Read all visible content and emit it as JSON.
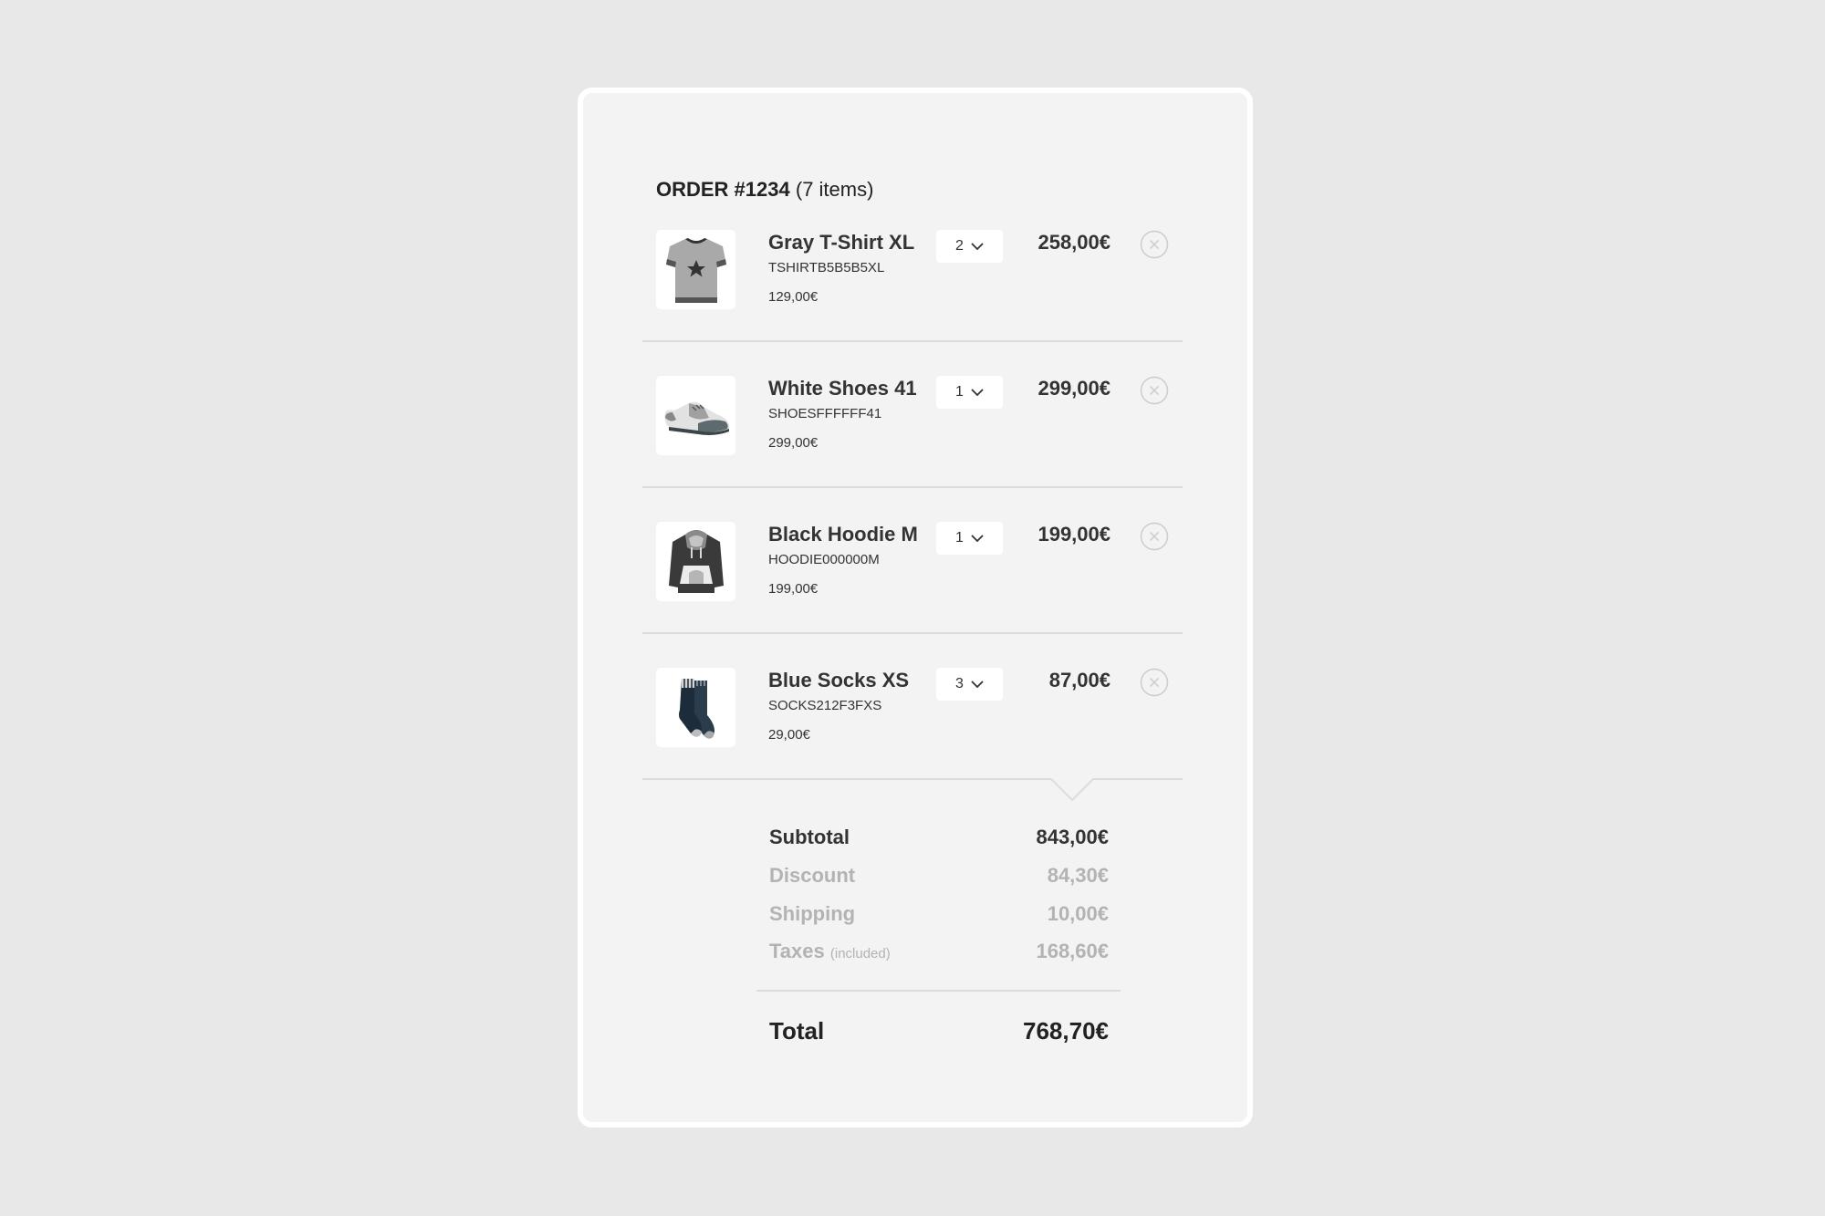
{
  "order": {
    "id_label": "ORDER #1234",
    "items_label": "(7 items)"
  },
  "items": [
    {
      "name": "Gray T-Shirt XL",
      "sku": "TSHIRTB5B5B5XL",
      "unit_price": "129,00€",
      "quantity": "2",
      "total": "258,00€",
      "icon": "t-shirt-icon"
    },
    {
      "name": "White Shoes 41",
      "sku": "SHOESFFFFFF41",
      "unit_price": "299,00€",
      "quantity": "1",
      "total": "299,00€",
      "icon": "shoe-icon"
    },
    {
      "name": "Black Hoodie M",
      "sku": "HOODIE000000M",
      "unit_price": "199,00€",
      "quantity": "1",
      "total": "199,00€",
      "icon": "hoodie-icon"
    },
    {
      "name": "Blue Socks XS",
      "sku": "SOCKS212F3FXS",
      "unit_price": "29,00€",
      "quantity": "3",
      "total": "87,00€",
      "icon": "socks-icon"
    }
  ],
  "summary": {
    "subtotal_label": "Subtotal",
    "subtotal_value": "843,00€",
    "discount_label": "Discount",
    "discount_value": "84,30€",
    "shipping_label": "Shipping",
    "shipping_value": "10,00€",
    "taxes_label": "Taxes",
    "taxes_note": "(included)",
    "taxes_value": "168,60€",
    "total_label": "Total",
    "total_value": "768,70€"
  },
  "colors": {
    "page_background": "#e8e8e8",
    "card_background": "#f3f3f3",
    "card_border": "#ffffff",
    "text_primary": "#333333",
    "text_muted": "#b3b3b3",
    "divider": "#dcdcdc"
  }
}
